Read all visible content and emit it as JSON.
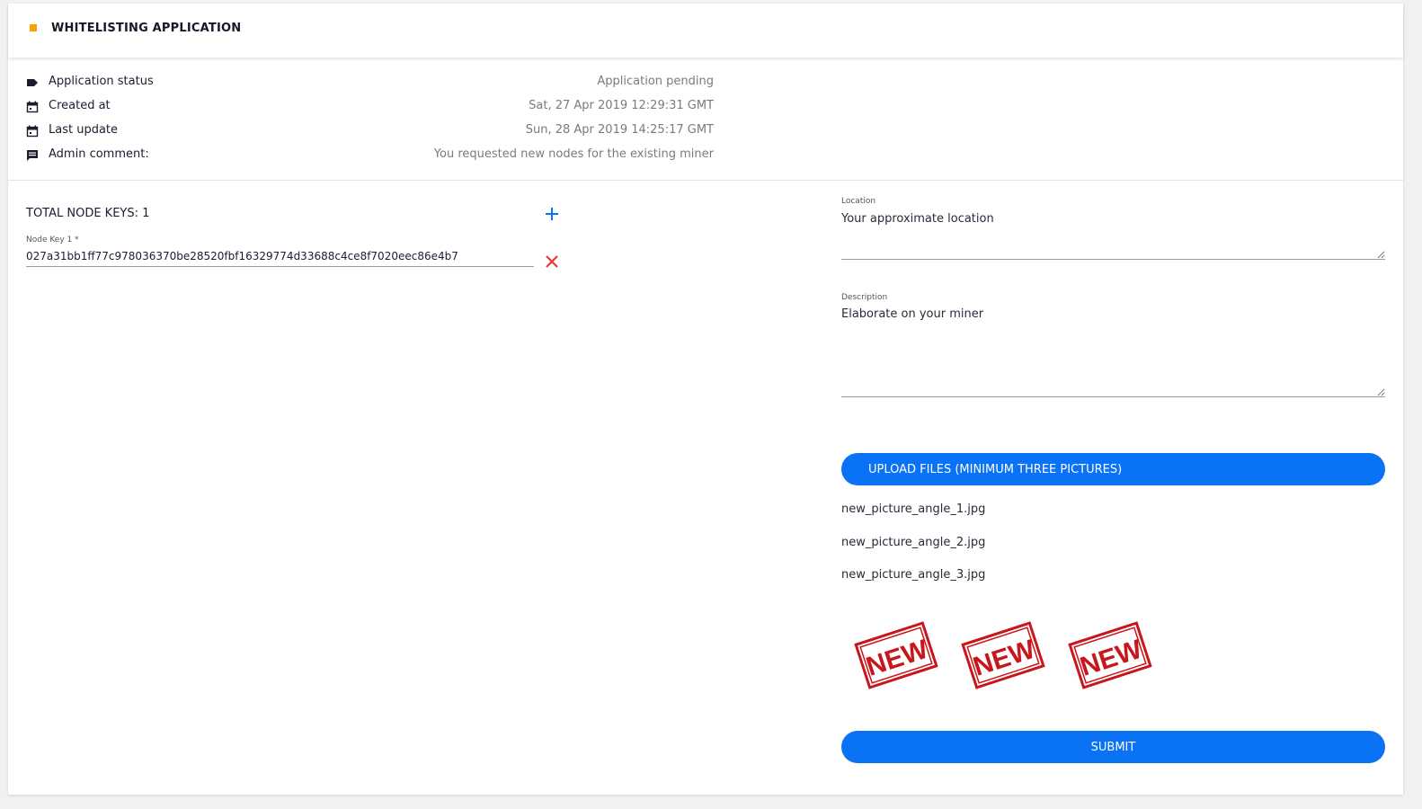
{
  "header": {
    "title": "WHITELISTING APPLICATION"
  },
  "info": [
    {
      "label": "Application status",
      "value": "Application pending",
      "icon": "label-icon"
    },
    {
      "label": "Created at",
      "value": "Sat, 27 Apr 2019 12:29:31 GMT",
      "icon": "calendar-icon"
    },
    {
      "label": "Last update",
      "value": "Sun, 28 Apr 2019 14:25:17 GMT",
      "icon": "calendar-icon"
    },
    {
      "label": "Admin comment:",
      "value": "You requested new nodes for the existing miner",
      "icon": "comment-icon"
    }
  ],
  "nodes": {
    "total_label": "TOTAL NODE KEYS: 1",
    "key_label": "Node Key 1 *",
    "key_value": "027a31bb1ff77c978036370be28520fbf16329774d33688c4ce8f7020eec86e4b7"
  },
  "form": {
    "location_label": "Location",
    "location_placeholder": "Your approximate location",
    "description_label": "Description",
    "description_placeholder": "Elaborate on your miner",
    "upload_label": "UPLOAD FILES (MINIMUM THREE PICTURES)",
    "files": [
      "new_picture_angle_1.jpg",
      "new_picture_angle_2.jpg",
      "new_picture_angle_3.jpg"
    ],
    "stamp_text": "NEW",
    "submit_label": "SUBMIT"
  },
  "colors": {
    "accent": "#0a72f5",
    "header_marker": "#f5a200",
    "stamp": "#c8161d",
    "remove": "#e53935"
  }
}
